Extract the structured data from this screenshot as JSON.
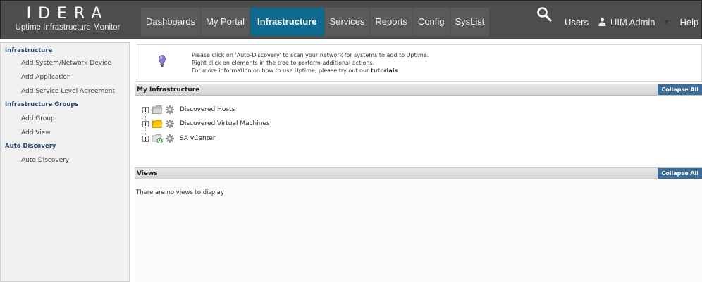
{
  "header": {
    "logo_text": "IDERA",
    "product_name": "Uptime Infrastructure Monitor",
    "nav": [
      {
        "label": "Dashboards",
        "active": false
      },
      {
        "label": "My Portal",
        "active": false
      },
      {
        "label": "Infrastructure",
        "active": true
      },
      {
        "label": "Services",
        "active": false
      },
      {
        "label": "Reports",
        "active": false
      },
      {
        "label": "Config",
        "active": false
      },
      {
        "label": "SysList",
        "active": false
      }
    ],
    "users_label": "Users",
    "account_label": "UIM Admin",
    "help_label": "Help"
  },
  "sidebar": {
    "sections": [
      {
        "heading": "Infrastructure",
        "items": [
          "Add System/Network Device",
          "Add Application",
          "Add Service Level Agreement"
        ]
      },
      {
        "heading": "Infrastructure Groups",
        "items": [
          "Add Group",
          "Add View"
        ]
      },
      {
        "heading": "Auto Discovery",
        "items": [
          "Auto Discovery"
        ]
      }
    ]
  },
  "info": {
    "line1": "Please click on 'Auto-Discovery' to scan your network for systems to add to Uptime.",
    "line2": "Right click on elements in the tree to perform additional actions.",
    "line3_prefix": "For more information on how to use Uptime, please try out our ",
    "line3_link": "tutorials"
  },
  "infrastructure": {
    "title": "My Infrastructure",
    "collapse_label": "Collapse All",
    "tree": [
      {
        "label": "Discovered Hosts",
        "icon": "gray-folder-icon"
      },
      {
        "label": "Discovered Virtual Machines",
        "icon": "yellow-folder-icon"
      },
      {
        "label": "SA vCenter",
        "icon": "vcenter-icon"
      }
    ]
  },
  "views": {
    "title": "Views",
    "collapse_label": "Collapse All",
    "empty_text": "There are no views to display"
  },
  "colors": {
    "header_bg": "#4d4d4d",
    "active_tab": "#0e6a8e",
    "collapse_button": "#3b6d98",
    "sidebar_heading": "#26466d"
  }
}
